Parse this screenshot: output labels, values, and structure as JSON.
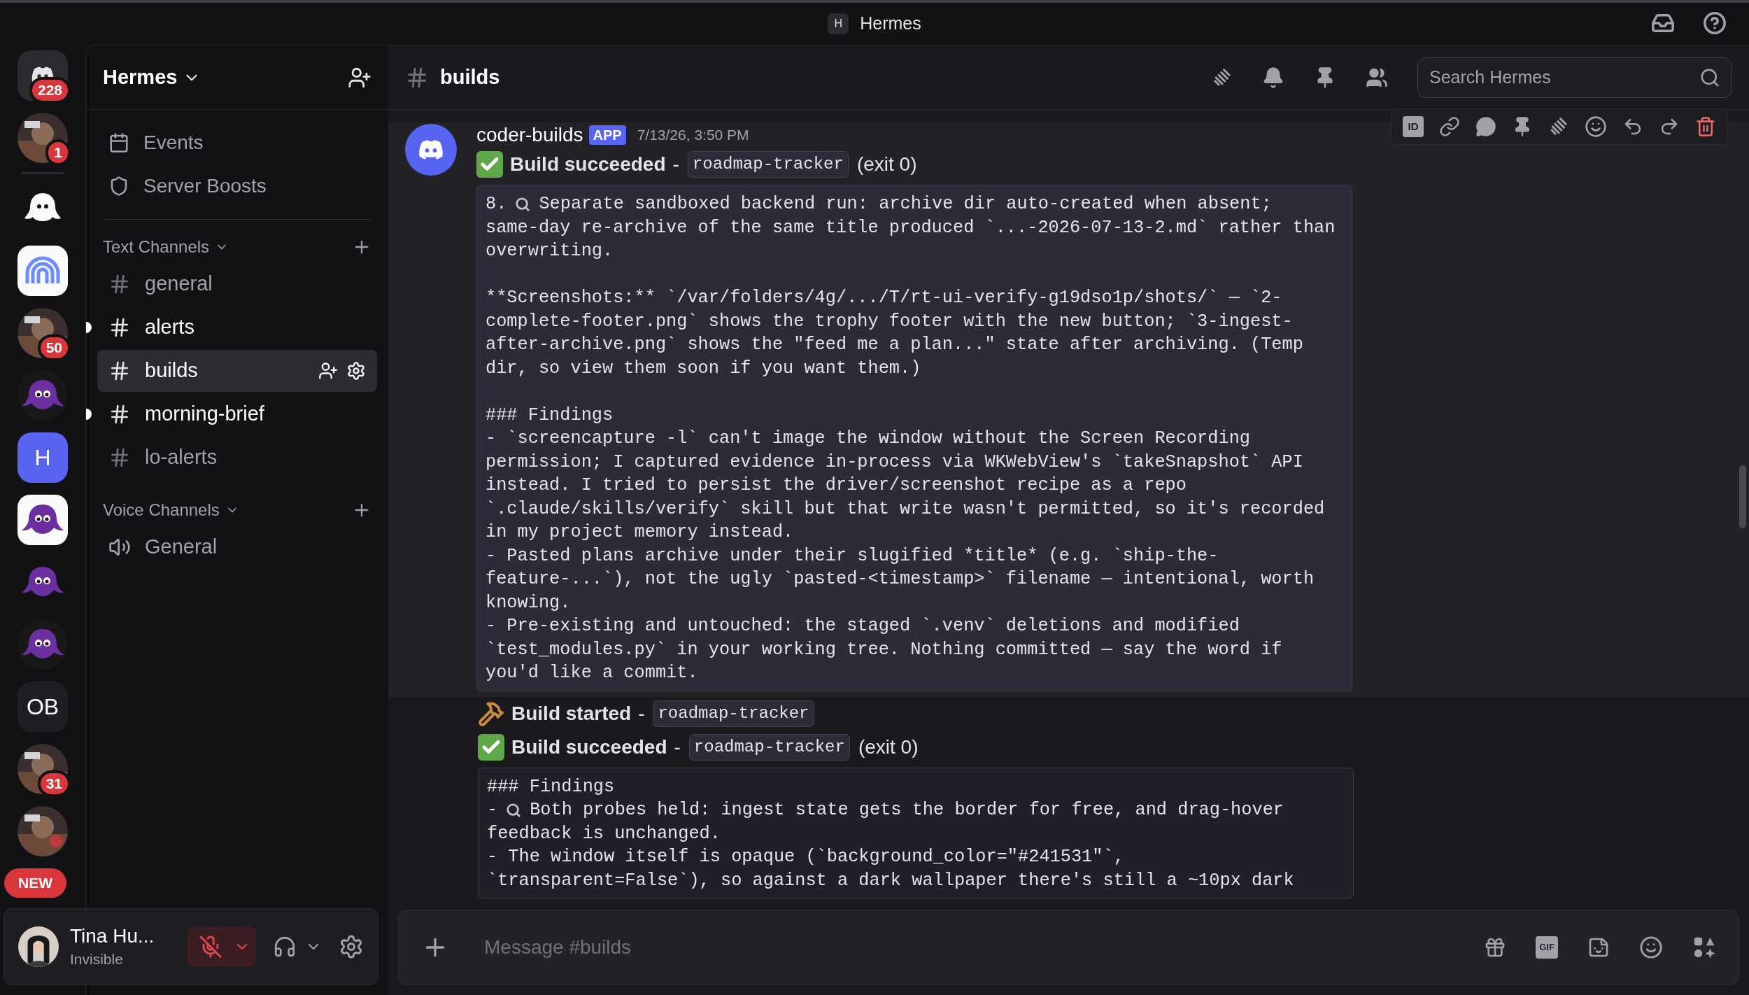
{
  "window": {
    "badge": "H",
    "title": "Hermes"
  },
  "servers": [
    {
      "kind": "home",
      "badge": "228"
    },
    {
      "kind": "picture",
      "badge": "1"
    },
    {
      "kind": "ghost"
    },
    {
      "kind": "arches"
    },
    {
      "kind": "picture",
      "badge": "50"
    },
    {
      "kind": "octopus-dark"
    },
    {
      "kind": "letter-accent",
      "label": "H"
    },
    {
      "kind": "octopus-light"
    },
    {
      "kind": "octopus-plain"
    },
    {
      "kind": "octopus-dark"
    },
    {
      "kind": "letter-dark",
      "label": "OB"
    },
    {
      "kind": "picture",
      "badge": "31"
    },
    {
      "kind": "picture"
    }
  ],
  "new_pill": "NEW",
  "server": {
    "name": "Hermes"
  },
  "shortcuts": [
    {
      "kind": "calendar",
      "label": "Events"
    },
    {
      "kind": "boost",
      "label": "Server Boosts"
    }
  ],
  "categories": [
    {
      "name": "Text Channels",
      "channels": [
        {
          "kind": "text",
          "name": "general",
          "unread": false,
          "selected": false
        },
        {
          "kind": "text",
          "name": "alerts",
          "unread": true,
          "selected": false
        },
        {
          "kind": "text",
          "name": "builds",
          "unread": false,
          "selected": true
        },
        {
          "kind": "text",
          "name": "morning-brief",
          "unread": true,
          "selected": false
        },
        {
          "kind": "text",
          "name": "lo-alerts",
          "unread": false,
          "selected": false
        }
      ]
    },
    {
      "name": "Voice Channels",
      "channels": [
        {
          "kind": "voice",
          "name": "General",
          "unread": false,
          "selected": false
        }
      ]
    }
  ],
  "user": {
    "name": "Tina Hu...",
    "status": "Invisible",
    "muted": true
  },
  "channel": {
    "name": "builds"
  },
  "search": {
    "placeholder": "Search Hermes"
  },
  "toolbar": {
    "id_label": "ID"
  },
  "message": {
    "author": "coder-builds",
    "tag": "APP",
    "time": "7/13/26, 3:50 PM",
    "hovered": true,
    "entries": [
      {
        "kind": "succeeded",
        "label": "Build succeeded",
        "sep": "-",
        "code": "roadmap-tracker",
        "suffix": "(exit 0)"
      },
      {
        "kind": "block",
        "lines": [
          {
            "kind": "marked",
            "lead": "8.",
            "text": "Separate sandboxed backend run: archive dir auto-created when absent;"
          },
          {
            "kind": "plain",
            "text": "same-day re-archive of the same title produced `...-2026-07-13-2.md` rather than overwriting."
          },
          {
            "kind": "blank"
          },
          {
            "kind": "plain",
            "text": "**Screenshots:** `/var/folders/4g/.../T/rt-ui-verify-g19dso1p/shots/` — `2-complete-footer.png` shows the trophy footer with the new button; `3-ingest-after-archive.png` shows the \"feed me a plan...\" state after archiving. (Temp dir, so view them soon if you want them.)"
          },
          {
            "kind": "blank"
          },
          {
            "kind": "plain",
            "text": "### Findings"
          },
          {
            "kind": "plain",
            "text": "- `screencapture -l` can't image the window without the Screen Recording permission; I captured evidence in-process via WKWebView's `takeSnapshot` API instead. I tried to persist the driver/screenshot recipe as a repo `.claude/skills/verify` skill but that write wasn't permitted, so it's recorded in my project memory instead."
          },
          {
            "kind": "plain",
            "text": "- Pasted plans archive under their slugified *title* (e.g. `ship-the-feature-...`), not the ugly `pasted-<timestamp>` filename — intentional, worth knowing."
          },
          {
            "kind": "plain",
            "text": "- Pre-existing and untouched: the staged `.venv` deletions and modified `test_modules.py` in your working tree. Nothing committed — say the word if you'd like a commit."
          }
        ]
      }
    ]
  },
  "followups": [
    {
      "kind": "started",
      "label": "Build started",
      "sep": "-",
      "code": "roadmap-tracker"
    },
    {
      "kind": "succeeded",
      "label": "Build succeeded",
      "sep": "-",
      "code": "roadmap-tracker",
      "suffix": "(exit 0)"
    },
    {
      "kind": "block",
      "lines": [
        {
          "kind": "plain",
          "text": "### Findings"
        },
        {
          "kind": "marked",
          "lead": "-",
          "text": "Both probes held: ingest state gets the border for free, and drag-hover"
        },
        {
          "kind": "plain",
          "text": "feedback is unchanged."
        },
        {
          "kind": "plain",
          "text": "- The window itself is opaque (`background_color=\"#241531\"`, `transparent=False`), so against a dark wallpaper there's still a ~10px dark"
        }
      ]
    }
  ],
  "composer": {
    "placeholder": "Message #builds",
    "gif": "GIF"
  }
}
